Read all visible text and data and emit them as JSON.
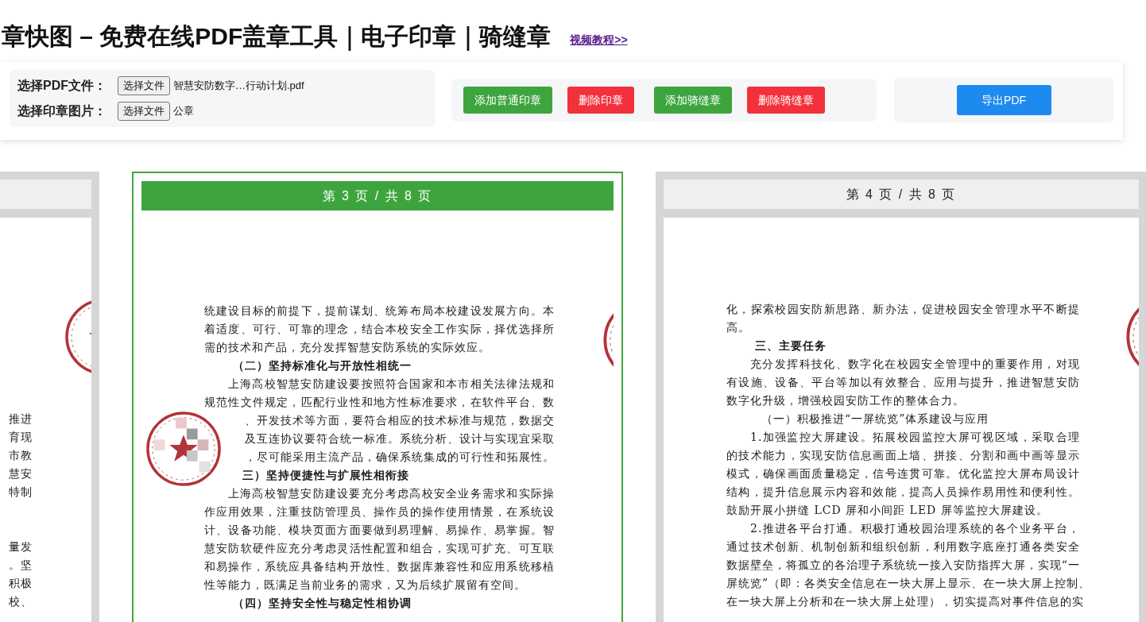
{
  "title": "章快图 – 免费在线PDF盖章工具｜电子印章｜骑缝章",
  "tutorial_link": "视频教程>>",
  "file_inputs": [
    {
      "label": "选择PDF文件：",
      "button": "选择文件",
      "file_name": "智慧安防数字…行动计划.pdf"
    },
    {
      "label": "选择印章图片：",
      "button": "选择文件",
      "file_name": "公章"
    }
  ],
  "actions": [
    {
      "label": "添加普通印章",
      "kind": "add"
    },
    {
      "label": "删除印章",
      "kind": "delete"
    },
    {
      "label": "添加骑缝章",
      "kind": "add"
    },
    {
      "label": "删除骑缝章",
      "kind": "delete"
    }
  ],
  "export_button": "导出PDF",
  "pages": [
    {
      "kind": "peek",
      "selected": false,
      "blocks": [
        [
          {
            "text": "推进",
            "kind": "tail"
          },
          {
            "text": "育现",
            "kind": "tail"
          },
          {
            "text": "市教",
            "kind": "tail"
          },
          {
            "text": "慧安",
            "kind": "tail"
          },
          {
            "text": "特制",
            "kind": "tail"
          }
        ],
        [
          {
            "text": "量发",
            "kind": "tail"
          },
          {
            "text": "。坚",
            "kind": "tail"
          },
          {
            "text": "积极",
            "kind": "tail"
          },
          {
            "text": "校、",
            "kind": "tail"
          }
        ]
      ]
    },
    {
      "kind": "full",
      "header": "第 3 页 / 共 8 页",
      "selected": true,
      "blocks": [
        [
          {
            "text": "统建设目标的前提下，提前谋划、统筹布局本校建设发展方向。本",
            "kind": "line"
          },
          {
            "text": "着适度、可行、可靠的理念，结合本校安全工作实际，择优选择所",
            "kind": "line"
          },
          {
            "text": "需的技术和产品，充分发挥智慧安防系统的实际效应。",
            "kind": "end"
          },
          {
            "text": "（二）坚持标准化与开放性相统一",
            "kind": "heading"
          },
          {
            "text": "上海高校智慧安防建设要按照符合国家和本市相关法律法规和",
            "kind": "indent"
          },
          {
            "text": "规范性文件规定，匹配行业性和地方性标准要求，在软件平台、数",
            "kind": "line"
          },
          {
            "text": "、开发技术等方面，要符合相应的技术标准与规范，数据交",
            "kind": "tail"
          },
          {
            "text": "及互连协议要符合统一标准。系统分析、设计与实现宜采取",
            "kind": "tail"
          },
          {
            "text": "，尽可能采用主流产品，确保系统集成的可行性和拓展性。",
            "kind": "tail"
          },
          {
            "text": "三）坚持便捷性与扩展性相衔接",
            "kind": "tail-heading"
          },
          {
            "text": "上海高校智慧安防建设要充分考虑高校安全业务需求和实际操",
            "kind": "indent"
          },
          {
            "text": "作应用效果，注重技防管理员、操作员的操作使用情景，在系统设",
            "kind": "line"
          },
          {
            "text": "计、设备功能、模块页面方面要做到易理解、易操作、易掌握。智",
            "kind": "line"
          },
          {
            "text": "慧安防软硬件应充分考虑灵活性配置和组合，实现可扩充、可互联",
            "kind": "line"
          },
          {
            "text": "和易操作，系统应具备结构开放性、数据库兼容性和应用系统移植",
            "kind": "line"
          },
          {
            "text": "性等能力，既满足当前业务的需求，又为后续扩展留有空间。",
            "kind": "end"
          },
          {
            "text": "（四）坚持安全性与稳定性相协调",
            "kind": "heading"
          }
        ]
      ]
    },
    {
      "kind": "full",
      "header": "第 4 页 / 共 8 页",
      "selected": false,
      "blocks": [
        [
          {
            "text": "化，探索校园安防新思路、新办法，促进校园安全管理水平不断提",
            "kind": "line"
          },
          {
            "text": "高。",
            "kind": "end"
          },
          {
            "text": "三、主要任务",
            "kind": "heading"
          },
          {
            "text": "充分发挥科技化、数字化在校园安全管理中的重要作用，对现",
            "kind": "indent"
          },
          {
            "text": "有设施、设备、平台等加以有效整合、应用与提升，推进智慧安防",
            "kind": "line"
          },
          {
            "text": "数字化升级，增强校园安防工作的整体合力。",
            "kind": "end"
          },
          {
            "text": "（一）积极推进“一屏统览”体系建设与应用",
            "kind": "subheading"
          },
          {
            "text": "1.加强监控大屏建设。拓展校园监控大屏可视区域，采取合理",
            "kind": "indent"
          },
          {
            "text": "的技术能力，实现安防信息画面上墙、拼接、分割和画中画等显示",
            "kind": "line"
          },
          {
            "text": "模式，确保画面质量稳定，信号连贯可靠。优化监控大屏布局设计",
            "kind": "line"
          },
          {
            "text": "结构，提升信息展示内容和效能，提高人员操作易用性和便利性。",
            "kind": "line"
          },
          {
            "text": "鼓励开展小拼缝 LCD 屏和小间距 LED 屏等监控大屏建设。",
            "kind": "end"
          },
          {
            "text": "2.推进各平台打通。积极打通校园治理系统的各个业务平台，",
            "kind": "indent"
          },
          {
            "text": "通过技术创新、机制创新和组织创新，利用数字底座打通各类安全",
            "kind": "line"
          },
          {
            "text": "数据壁垒，将孤立的各治理子系统统一接入安防指挥大屏，实现“一",
            "kind": "line"
          },
          {
            "text": "屏统览”（即：各类安全信息在一块大屏上显示、在一块大屏上控制、",
            "kind": "line"
          },
          {
            "text": "在一块大屏上分析和在一块大屏上处理），切实提高对事件信息的实",
            "kind": "line"
          }
        ]
      ]
    }
  ]
}
